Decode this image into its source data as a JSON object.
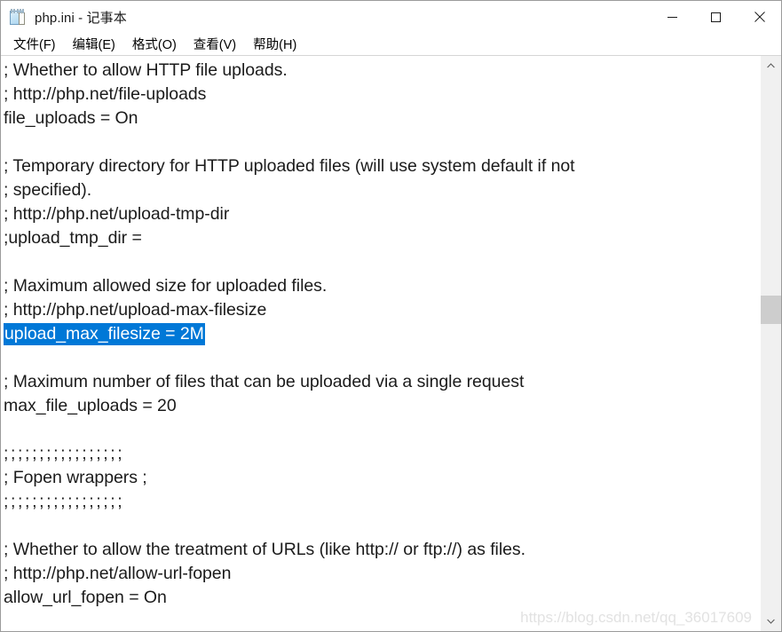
{
  "window": {
    "title": "php.ini - 记事本",
    "icon": "notepad-icon",
    "controls": {
      "minimize_label": "最小化",
      "maximize_label": "最大化",
      "close_label": "关闭"
    }
  },
  "menu": {
    "items": [
      {
        "label": "文件(F)",
        "name": "menu-file"
      },
      {
        "label": "编辑(E)",
        "name": "menu-edit"
      },
      {
        "label": "格式(O)",
        "name": "menu-format"
      },
      {
        "label": "查看(V)",
        "name": "menu-view"
      },
      {
        "label": "帮助(H)",
        "name": "menu-help"
      }
    ]
  },
  "editor": {
    "selection": {
      "text": "upload_max_filesize = 2M",
      "highlight_color": "#0078d7",
      "text_color": "#ffffff"
    },
    "lines": [
      "; Whether to allow HTTP file uploads.",
      "; http://php.net/file-uploads",
      "file_uploads = On",
      "",
      "; Temporary directory for HTTP uploaded files (will use system default if not",
      "; specified).",
      "; http://php.net/upload-tmp-dir",
      ";upload_tmp_dir =",
      "",
      "; Maximum allowed size for uploaded files.",
      "; http://php.net/upload-max-filesize",
      "upload_max_filesize = 2M",
      "",
      "; Maximum number of files that can be uploaded via a single request",
      "max_file_uploads = 20",
      "",
      ";;;;;;;;;;;;;;;;;",
      "; Fopen wrappers ;",
      ";;;;;;;;;;;;;;;;;",
      "",
      "; Whether to allow the treatment of URLs (like http:// or ftp://) as files.",
      "; http://php.net/allow-url-fopen",
      "allow_url_fopen = On"
    ]
  },
  "watermark": {
    "text": "https://blog.csdn.net/qq_36017609"
  },
  "scrollbar": {
    "up_label": "向上滚动",
    "down_label": "向下滚动"
  }
}
